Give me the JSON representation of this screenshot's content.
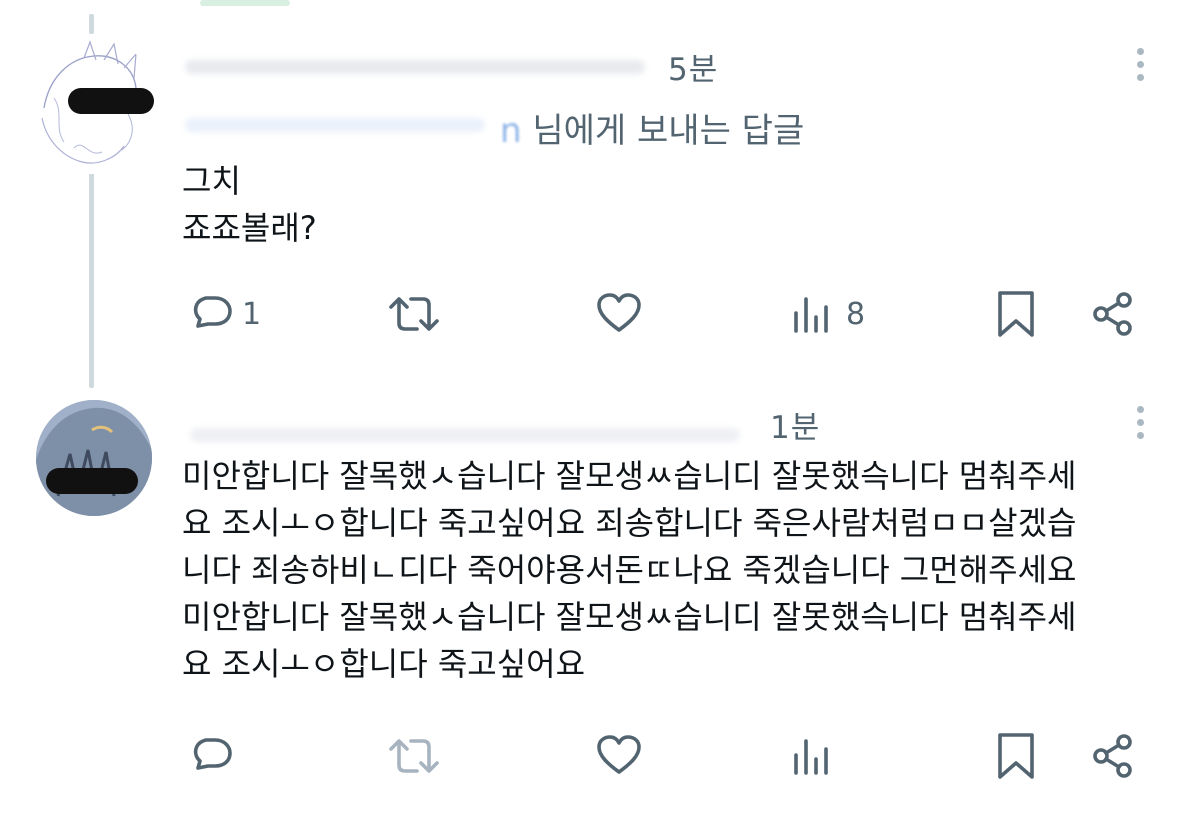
{
  "tweets": [
    {
      "time": "5분",
      "reply_to_suffix": "님에게 보내는 답글",
      "reply_to_handle_tail": "n",
      "text": "그치\n죠죠볼래?",
      "actions": {
        "reply_count": "1",
        "retweet_count": "",
        "like_count": "",
        "views_count": "8"
      }
    },
    {
      "time": "1분",
      "text": "미안합니다 잘목했ㅅ습니다 잘모생ㅆ습니디 잘못했슥니다 멈춰주세\n요 조시ㅗㅇ합니다 죽고싶어요 죄송합니다 죽은사람처럼ㅁㅁ살겠습\n니다 죄송하비ㄴ디다 죽어야용서돈ㄸ나요 죽겠습니다 그먼해주세요\n미안합니다 잘목했ㅅ습니다 잘모생ㅆ습니디 잘못했슥니다 멈춰주세\n요 조시ㅗㅇ합니다 죽고싶어요",
      "actions": {
        "reply_count": "",
        "retweet_count": "",
        "like_count": "",
        "views_count": ""
      }
    }
  ],
  "icons": {
    "reply": "reply-icon",
    "retweet": "retweet-icon",
    "like": "heart-icon",
    "views": "views-icon",
    "bookmark": "bookmark-icon",
    "share": "share-icon",
    "more": "more-icon"
  },
  "colors": {
    "icon": "#536471",
    "icon_dim": "#a7b4bf",
    "thread_line": "#cfd9de",
    "text": "#0f1419"
  }
}
